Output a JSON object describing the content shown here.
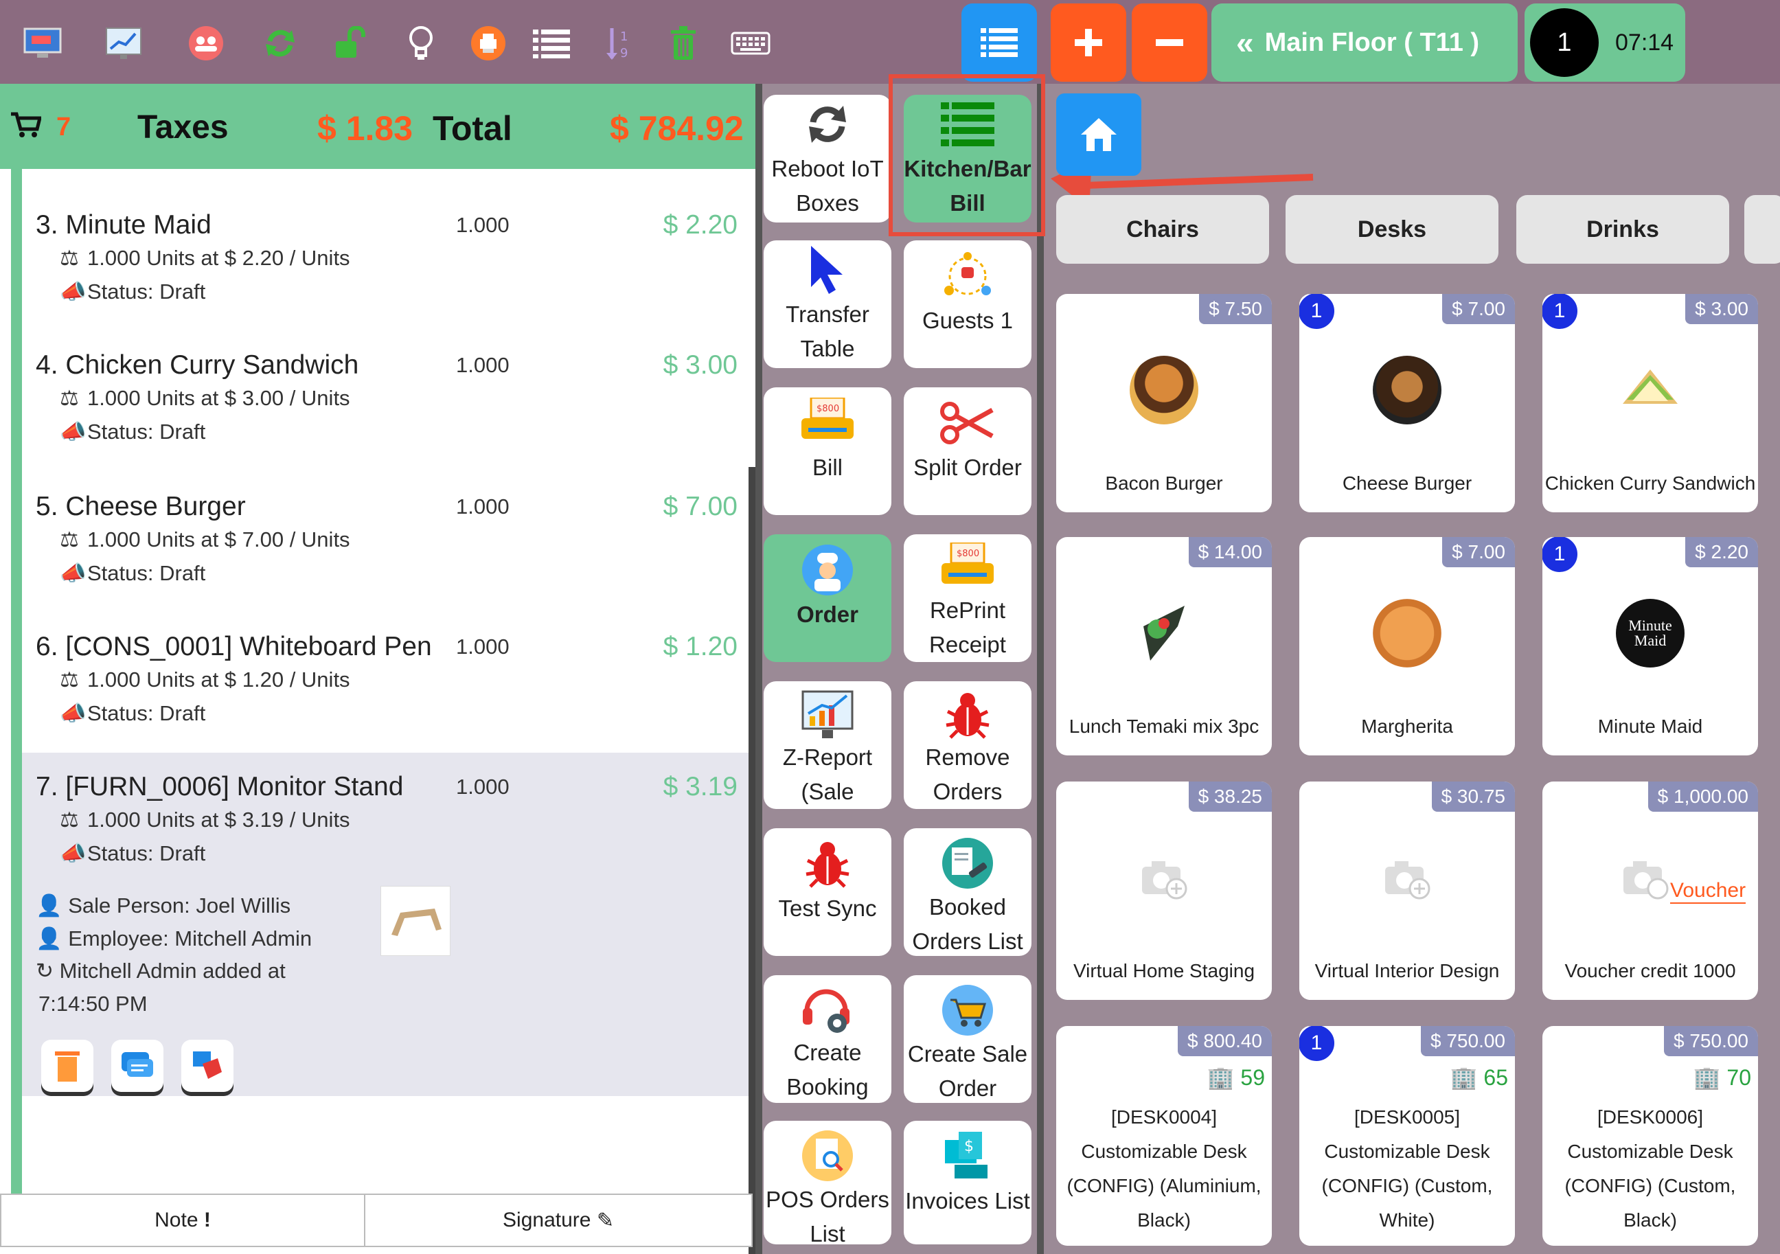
{
  "topbar": {
    "icons": [
      "monitor-icon",
      "report-chart-icon",
      "people-icon",
      "refresh-icon",
      "unlock-icon",
      "lightbulb-icon",
      "printer-icon",
      "list-icon",
      "sort-icon",
      "trash-icon",
      "keyboard-icon"
    ],
    "floor_label": "Main Floor ( T11 )",
    "guest_count": "1",
    "time": "07:14"
  },
  "order": {
    "item_count": "7",
    "taxes_label": "Taxes",
    "taxes_value": "$ 1.83",
    "total_label": "Total",
    "total_value": "$ 784.92",
    "lines": [
      {
        "name": "3. Minute Maid",
        "qty": "1.000",
        "price": "$ 2.20",
        "units": "1.000 Units at $ 2.20 / Units",
        "status": "Status: Draft"
      },
      {
        "name": "4. Chicken Curry Sandwich",
        "qty": "1.000",
        "price": "$ 3.00",
        "units": "1.000 Units at $ 3.00 / Units",
        "status": "Status: Draft"
      },
      {
        "name": "5. Cheese Burger",
        "qty": "1.000",
        "price": "$ 7.00",
        "units": "1.000 Units at $ 7.00 / Units",
        "status": "Status: Draft"
      },
      {
        "name": "6. [CONS_0001] Whiteboard Pen",
        "qty": "1.000",
        "price": "$ 1.20",
        "units": "1.000 Units at $ 1.20 / Units",
        "status": "Status: Draft"
      },
      {
        "name": "7. [FURN_0006] Monitor Stand",
        "qty": "1.000",
        "price": "$ 3.19",
        "units": "1.000 Units at $ 3.19 / Units",
        "status": "Status: Draft"
      }
    ],
    "selected": {
      "sale_person": "Sale Person: Joel Willis",
      "employee": "Employee: Mitchell Admin",
      "added_by": "Mitchell Admin added at",
      "added_time": "7:14:50 PM"
    },
    "note_label": "Note",
    "signature_label": "Signature"
  },
  "actions": [
    {
      "label1": "Reboot IoT",
      "label2": "Boxes",
      "icon": "reboot-icon"
    },
    {
      "label1": "Kitchen/Bar",
      "label2": "Bill",
      "icon": "kitchen-bill-icon"
    },
    {
      "label1": "Transfer",
      "label2": "Table",
      "icon": "cursor-icon"
    },
    {
      "label1": "Guests 1",
      "label2": "",
      "icon": "guests-icon"
    },
    {
      "label1": "Bill",
      "label2": "",
      "icon": "bill-printer-icon"
    },
    {
      "label1": "Split Order",
      "label2": "",
      "icon": "scissors-icon"
    },
    {
      "label1": "Order",
      "label2": "",
      "icon": "chef-icon"
    },
    {
      "label1": "RePrint",
      "label2": "Receipt",
      "icon": "receipt-printer-icon"
    },
    {
      "label1": "Z-Report",
      "label2": "(Sale",
      "icon": "z-report-icon"
    },
    {
      "label1": "Remove",
      "label2": "Orders",
      "icon": "bug-icon"
    },
    {
      "label1": "Test Sync",
      "label2": "",
      "icon": "bug-icon"
    },
    {
      "label1": "Booked",
      "label2": "Orders List",
      "icon": "booked-icon"
    },
    {
      "label1": "Create",
      "label2": "Booking",
      "icon": "headset-icon"
    },
    {
      "label1": "Create Sale",
      "label2": "Order",
      "icon": "cart-icon"
    },
    {
      "label1": "POS Orders",
      "label2": "List",
      "icon": "search-doc-icon"
    },
    {
      "label1": "Invoices List",
      "label2": "",
      "icon": "invoice-icon"
    }
  ],
  "categories": [
    "Chairs",
    "Desks",
    "Drinks"
  ],
  "products": [
    {
      "name": "Bacon Burger",
      "price": "$ 7.50",
      "badge": ""
    },
    {
      "name": "Cheese Burger",
      "price": "$ 7.00",
      "badge": "1"
    },
    {
      "name": "Chicken Curry Sandwich",
      "price": "$ 3.00",
      "badge": "1"
    },
    {
      "name": "Lunch Temaki mix 3pc",
      "price": "$ 14.00",
      "badge": ""
    },
    {
      "name": "Margherita",
      "price": "$ 7.00",
      "badge": ""
    },
    {
      "name": "Minute Maid",
      "price": "$ 2.20",
      "badge": "1"
    },
    {
      "name": "Virtual Home Staging",
      "price": "$ 38.25",
      "badge": ""
    },
    {
      "name": "Virtual Interior Design",
      "price": "$ 30.75",
      "badge": ""
    },
    {
      "name": "Voucher credit 1000",
      "price": "$ 1,000.00",
      "badge": ""
    }
  ],
  "desks": [
    {
      "price": "$ 800.40",
      "stock": "59",
      "l1": "[DESK0004]",
      "l2": "Customizable Desk",
      "l3": "(CONFIG) (Aluminium,",
      "l4": "Black)",
      "badge": ""
    },
    {
      "price": "$ 750.00",
      "stock": "65",
      "l1": "[DESK0005]",
      "l2": "Customizable Desk",
      "l3": "(CONFIG) (Custom,",
      "l4": "White)",
      "badge": "1"
    },
    {
      "price": "$ 750.00",
      "stock": "70",
      "l1": "[DESK0006]",
      "l2": "Customizable Desk",
      "l3": "(CONFIG) (Custom,",
      "l4": "Black)",
      "badge": ""
    }
  ],
  "image_labels": {
    "minute_maid_logo": "Minute Maid",
    "voucher": "Voucher"
  },
  "colors": {
    "header_green": "#6fc795",
    "topbar": "#8b6b80",
    "accent_blue": "#2196f3",
    "accent_orange": "#ff5a1f",
    "price_tag": "#8b8fb8",
    "highlight_red": "#e74c3c"
  }
}
